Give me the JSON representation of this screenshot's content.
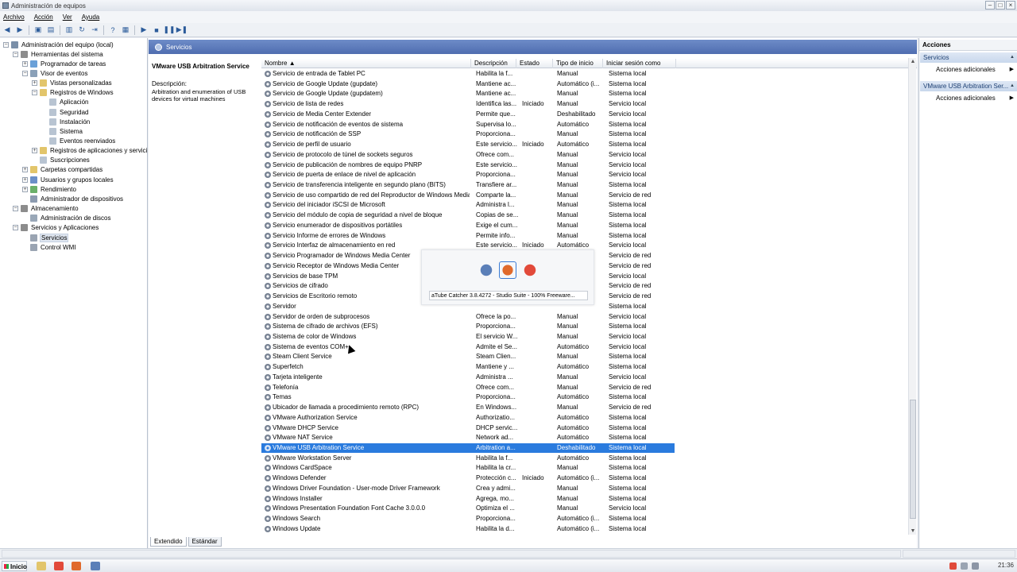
{
  "window": {
    "title": "Administración de equipos"
  },
  "menu": [
    "Archivo",
    "Acción",
    "Ver",
    "Ayuda"
  ],
  "tree": {
    "items": [
      {
        "label": "Administración del equipo (local)",
        "level": 0,
        "expander": "−",
        "icon_color": "#7a8fa8",
        "icon": "computer-management-icon"
      },
      {
        "label": "Herramientas del sistema",
        "level": 1,
        "expander": "−",
        "icon_color": "#8c8c8c",
        "icon": "tools-icon"
      },
      {
        "label": "Programador de tareas",
        "level": 2,
        "expander": "+",
        "icon_color": "#6aa0d8",
        "icon": "clock-icon"
      },
      {
        "label": "Visor de eventos",
        "level": 2,
        "expander": "−",
        "icon_color": "#8aa0b8",
        "icon": "event-viewer-icon"
      },
      {
        "label": "Vistas personalizadas",
        "level": 3,
        "expander": "+",
        "icon_color": "#e2c56b",
        "icon": "folder-icon"
      },
      {
        "label": "Registros de Windows",
        "level": 3,
        "expander": "−",
        "icon_color": "#e2c56b",
        "icon": "folder-icon"
      },
      {
        "label": "Aplicación",
        "level": 4,
        "expander": "",
        "icon_color": "#b8c4d2",
        "icon": "log-icon"
      },
      {
        "label": "Seguridad",
        "level": 4,
        "expander": "",
        "icon_color": "#b8c4d2",
        "icon": "log-icon"
      },
      {
        "label": "Instalación",
        "level": 4,
        "expander": "",
        "icon_color": "#b8c4d2",
        "icon": "log-icon"
      },
      {
        "label": "Sistema",
        "level": 4,
        "expander": "",
        "icon_color": "#b8c4d2",
        "icon": "log-icon"
      },
      {
        "label": "Eventos reenviados",
        "level": 4,
        "expander": "",
        "icon_color": "#b8c4d2",
        "icon": "log-icon"
      },
      {
        "label": "Registros de aplicaciones y servicios",
        "level": 3,
        "expander": "+",
        "icon_color": "#e2c56b",
        "icon": "folder-icon"
      },
      {
        "label": "Suscripciones",
        "level": 3,
        "expander": "",
        "icon_color": "#b8c4d2",
        "icon": "subscription-icon"
      },
      {
        "label": "Carpetas compartidas",
        "level": 2,
        "expander": "+",
        "icon_color": "#e2c56b",
        "icon": "shared-folder-icon"
      },
      {
        "label": "Usuarios y grupos locales",
        "level": 2,
        "expander": "+",
        "icon_color": "#6a8fc8",
        "icon": "users-icon"
      },
      {
        "label": "Rendimiento",
        "level": 2,
        "expander": "+",
        "icon_color": "#6ab06a",
        "icon": "performance-icon"
      },
      {
        "label": "Administrador de dispositivos",
        "level": 2,
        "expander": "",
        "icon_color": "#8c9bb0",
        "icon": "device-manager-icon"
      },
      {
        "label": "Almacenamiento",
        "level": 1,
        "expander": "−",
        "icon_color": "#8c8c8c",
        "icon": "storage-icon"
      },
      {
        "label": "Administración de discos",
        "level": 2,
        "expander": "",
        "icon_color": "#9aa8b8",
        "icon": "disk-icon"
      },
      {
        "label": "Servicios y Aplicaciones",
        "level": 1,
        "expander": "−",
        "icon_color": "#8c8c8c",
        "icon": "services-apps-icon"
      },
      {
        "label": "Servicios",
        "level": 2,
        "expander": "",
        "icon_color": "#9aa4b2",
        "icon": "gear-icon",
        "selected": true
      },
      {
        "label": "Control WMI",
        "level": 2,
        "expander": "",
        "icon_color": "#9aa4b2",
        "icon": "wmi-icon"
      }
    ]
  },
  "center": {
    "header": "Servicios",
    "selected_service": "VMware USB Arbitration Service",
    "description_label": "Descripción:",
    "description_text": "Arbitration and enumeration of USB devices for virtual machines",
    "columns": [
      "Nombre",
      "Descripción",
      "Estado",
      "Tipo de inicio",
      "Iniciar sesión como"
    ],
    "rows": [
      [
        "Servicio de entrada de Tablet PC",
        "Habilita la f...",
        "",
        "Manual",
        "Sistema local"
      ],
      [
        "Servicio de Google Update (gupdate)",
        "Mantiene ac...",
        "",
        "Automático (i...",
        "Sistema local"
      ],
      [
        "Servicio de Google Update (gupdatem)",
        "Mantiene ac...",
        "",
        "Manual",
        "Sistema local"
      ],
      [
        "Servicio de lista de redes",
        "Identifica las...",
        "Iniciado",
        "Manual",
        "Servicio local"
      ],
      [
        "Servicio de Media Center Extender",
        "Permite que...",
        "",
        "Deshabilitado",
        "Servicio local"
      ],
      [
        "Servicio de notificación de eventos de sistema",
        "Supervisa lo...",
        "",
        "Automático",
        "Sistema local"
      ],
      [
        "Servicio de notificación de SSP",
        "Proporciona...",
        "",
        "Manual",
        "Sistema local"
      ],
      [
        "Servicio de perfil de usuario",
        "Este servicio...",
        "Iniciado",
        "Automático",
        "Sistema local"
      ],
      [
        "Servicio de protocolo de túnel de sockets seguros",
        "Ofrece com...",
        "",
        "Manual",
        "Servicio local"
      ],
      [
        "Servicio de publicación de nombres de equipo PNRP",
        "Este servicio...",
        "",
        "Manual",
        "Servicio local"
      ],
      [
        "Servicio de puerta de enlace de nivel de aplicación",
        "Proporciona...",
        "",
        "Manual",
        "Servicio local"
      ],
      [
        "Servicio de transferencia inteligente en segundo plano (BITS)",
        "Transfiere ar...",
        "",
        "Manual",
        "Sistema local"
      ],
      [
        "Servicio de uso compartido de red del Reproductor de Windows Media",
        "Comparte la...",
        "",
        "Manual",
        "Servicio de red"
      ],
      [
        "Servicio del iniciador iSCSI de Microsoft",
        "Administra l...",
        "",
        "Manual",
        "Sistema local"
      ],
      [
        "Servicio del módulo de copia de seguridad a nivel de bloque",
        "Copias de se...",
        "",
        "Manual",
        "Sistema local"
      ],
      [
        "Servicio enumerador de dispositivos portátiles",
        "Exige el cum...",
        "",
        "Manual",
        "Sistema local"
      ],
      [
        "Servicio Informe de errores de Windows",
        "Permite info...",
        "",
        "Manual",
        "Sistema local"
      ],
      [
        "Servicio Interfaz de almacenamiento en red",
        "Este servicio...",
        "Iniciado",
        "Automático",
        "Servicio local"
      ],
      [
        "Servicio Programador de Windows Media Center",
        "",
        "",
        "",
        "Servicio de red"
      ],
      [
        "Servicio Receptor de Windows Media Center",
        "",
        "",
        "",
        "Servicio de red"
      ],
      [
        "Servicios de base TPM",
        "",
        "",
        "",
        "Servicio local"
      ],
      [
        "Servicios de cifrado",
        "",
        "",
        "",
        "Servicio de red"
      ],
      [
        "Servicios de Escritorio remoto",
        "",
        "",
        "",
        "Servicio de red"
      ],
      [
        "Servidor",
        "",
        "",
        "",
        "Sistema local"
      ],
      [
        "Servidor de orden de subprocesos",
        "Ofrece la po...",
        "",
        "Manual",
        "Servicio local"
      ],
      [
        "Sistema de cifrado de archivos (EFS)",
        "Proporciona...",
        "",
        "Manual",
        "Sistema local"
      ],
      [
        "Sistema de color de Windows",
        "El servicio W...",
        "",
        "Manual",
        "Servicio local"
      ],
      [
        "Sistema de eventos COM+",
        "Admite el Se...",
        "",
        "Automático",
        "Servicio local"
      ],
      [
        "Steam Client Service",
        "Steam Clien...",
        "",
        "Manual",
        "Sistema local"
      ],
      [
        "Superfetch",
        "Mantiene y ...",
        "",
        "Automático",
        "Sistema local"
      ],
      [
        "Tarjeta inteligente",
        "Administra ...",
        "",
        "Manual",
        "Servicio local"
      ],
      [
        "Telefonía",
        "Ofrece com...",
        "",
        "Manual",
        "Servicio de red"
      ],
      [
        "Temas",
        "Proporciona...",
        "",
        "Automático",
        "Sistema local"
      ],
      [
        "Ubicador de llamada a procedimiento remoto (RPC)",
        "En Windows...",
        "",
        "Manual",
        "Servicio de red"
      ],
      [
        "VMware Authorization Service",
        "Authorizatio...",
        "",
        "Automático",
        "Sistema local"
      ],
      [
        "VMware DHCP Service",
        "DHCP servic...",
        "",
        "Automático",
        "Sistema local"
      ],
      [
        "VMware NAT Service",
        "Network ad...",
        "",
        "Automático",
        "Sistema local"
      ],
      [
        "VMware USB Arbitration Service",
        "Arbitration a...",
        "",
        "Deshabilitado",
        "Sistema local"
      ],
      [
        "VMware Workstation Server",
        "Habilita la f...",
        "",
        "Automático",
        "Sistema local"
      ],
      [
        "Windows CardSpace",
        "Habilita la cr...",
        "",
        "Manual",
        "Sistema local"
      ],
      [
        "Windows Defender",
        "Protección c...",
        "Iniciado",
        "Automático (i...",
        "Sistema local"
      ],
      [
        "Windows Driver Foundation - User-mode Driver Framework",
        "Crea y admi...",
        "",
        "Manual",
        "Sistema local"
      ],
      [
        "Windows Installer",
        "Agrega, mo...",
        "",
        "Manual",
        "Sistema local"
      ],
      [
        "Windows Presentation Foundation Font Cache 3.0.0.0",
        "Optimiza el ...",
        "",
        "Manual",
        "Servicio local"
      ],
      [
        "Windows Search",
        "Proporciona...",
        "",
        "Automático (i...",
        "Sistema local"
      ],
      [
        "Windows Update",
        "Habilita la d...",
        "",
        "Automático (i...",
        "Sistema local"
      ]
    ],
    "selected_row_index": 37,
    "tabs": [
      "Extendido",
      "Estándar"
    ],
    "active_tab": 0
  },
  "actions": {
    "title": "Acciones",
    "sections": [
      {
        "label": "Servicios",
        "items": [
          "Acciones adicionales"
        ]
      },
      {
        "label": "VMware USB Arbitration Ser...",
        "items": [
          "Acciones adicionales"
        ]
      }
    ]
  },
  "popup": {
    "caption": "aTube Catcher 3.8.4272 - Studio Suite - 100% Freeware...",
    "icons": [
      {
        "name": "computer-management-icon",
        "color": "#5b7fb8"
      },
      {
        "name": "atube-catcher-icon",
        "color": "#e06a2c"
      },
      {
        "name": "chrome-icon",
        "color": "#e24a3a"
      }
    ],
    "selected_icon": 1
  },
  "taskbar": {
    "start_label": "Inicio",
    "clock": "21:36",
    "apps": [
      {
        "name": "explorer-icon",
        "color": "#e2c56b"
      },
      {
        "name": "chrome-icon",
        "color": "#e24a3a"
      },
      {
        "name": "atube-catcher-icon",
        "color": "#e06a2c"
      },
      {
        "name": "computer-management-icon",
        "color": "#5b7fb8"
      }
    ]
  },
  "colors": {
    "selection": "#2a7bde",
    "header": "#4f6db0"
  }
}
